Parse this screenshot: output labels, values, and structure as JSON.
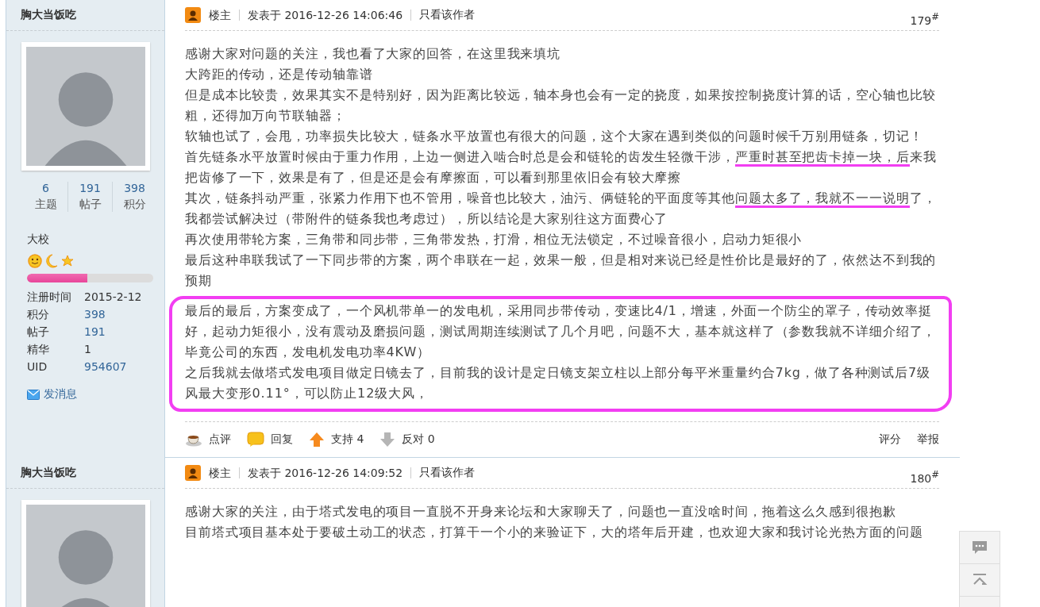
{
  "posts": [
    {
      "author": "胸大当饭吃",
      "stats": [
        {
          "value": "6",
          "label": "主题"
        },
        {
          "value": "191",
          "label": "帖子"
        },
        {
          "value": "398",
          "label": "积分"
        }
      ],
      "rank": "大校",
      "level": 0.48,
      "info": [
        {
          "label": "注册时间",
          "value": "2015-2-12",
          "linked": false
        },
        {
          "label": "积分",
          "value": "398",
          "linked": true
        },
        {
          "label": "帖子",
          "value": "191",
          "linked": true
        },
        {
          "label": "精华",
          "value": "1",
          "linked": false
        },
        {
          "label": "UID",
          "value": "954607",
          "linked": true
        }
      ],
      "message": "发消息",
      "badge": "楼主",
      "time": "发表于 2016-12-26 14:06:46",
      "only_author": "只看该作者",
      "floor": "179$^{#}$",
      "blocks": [
        {
          "highlighted": false,
          "paragraphs": [
            [
              {
                "text": "感谢大家对问题的关注，我也看了大家的回答，在这里我来填坑",
                "underlined": false
              }
            ],
            [
              {
                "text": "大跨距的传动，还是传动轴靠谱",
                "underlined": false
              }
            ],
            [
              {
                "text": "但是成本比较贵，效果其实不是特别好，因为距离比较远，轴本身也会有一定的挠度，如果按控制挠度计算的话，空心轴也比较粗，还得加万向节联轴器；",
                "underlined": false
              }
            ],
            [
              {
                "text": "软轴也试了，会甩，功率损失比较大，链条水平放置也有很大的问题，这个大家在遇到类似的问题时候千万别用链条，切记！",
                "underlined": false
              }
            ],
            [
              {
                "text": "首先链条水平放置时候由于重力作用，上边一侧进入啮合时总是会和链轮的齿发生轻微干涉，",
                "underlined": false
              },
              {
                "text": "严重时甚至把齿卡掉一块，后",
                "underlined": true
              },
              {
                "text": "来我把齿修了一下，效果是有了，但是还是会有摩擦面，可以看到那里依旧会有较大摩擦",
                "underlined": false
              }
            ],
            [
              {
                "text": "其次，链条抖动严重，张紧力作用下也不管用，噪音也比较大，油污、俩链轮的平面度等其他",
                "underlined": false
              },
              {
                "text": "问题太多了，我就不一一说明",
                "underlined": true
              },
              {
                "text": "了，我都尝试解决过（带附件的链条我也考虑过），所以结论是大家别往这方面费心了",
                "underlined": false
              }
            ],
            [
              {
                "text": "再次使用带轮方案，三角带和同步带，三角带发热，打滑，相位无法锁定，不过噪音很小，启动力矩很小",
                "underlined": false
              }
            ],
            [
              {
                "text": "最后这种串联我试了一下同步带的方案，两个串联在一起，效果一般，但是相对来说已经是性价比是最好的了，依然达不到我的预期",
                "underlined": false
              }
            ]
          ]
        },
        {
          "highlighted": true,
          "paragraphs": [
            [
              {
                "text": "最后的最后，方案变成了，一个风机带单一的发电机，采用同步带传动，变速比4/1，增速，外面一个防尘的罩子，传动效率挺好，起动力矩很小，没有震动及磨损问题，测试周期连续测试了几个月吧，问题不大，基本就这样了（参数我就不详细介绍了，毕竟公司的东西，发电机发电功率4KW）",
                "underlined": false
              }
            ],
            [
              {
                "text": "之后我就去做塔式发电项目做定日镜去了，目前我的设计是定日镜支架立柱以上部分每平米重量约合7kg，做了各种测试后7级风最大变形0.11°，可以防止12级大风，",
                "underlined": false
              }
            ]
          ]
        }
      ],
      "actions": [
        {
          "kind": "rate",
          "label": "点评"
        },
        {
          "kind": "reply",
          "label": "回复"
        },
        {
          "kind": "up",
          "label": "支持 4"
        },
        {
          "kind": "down",
          "label": "反对 0"
        }
      ],
      "side_actions": [
        "评分",
        "举报"
      ]
    },
    {
      "author": "胸大当饭吃",
      "badge": "楼主",
      "time": "发表于 2016-12-26 14:09:52",
      "only_author": "只看该作者",
      "floor": "180$^{#}$",
      "blocks": [
        {
          "highlighted": false,
          "paragraphs": [
            [
              {
                "text": "感谢大家的关注，由于塔式发电的项目一直脱不开身来论坛和大家聊天了，问题也一直没啥时间，拖着这么久感到很抱歉",
                "underlined": false
              }
            ],
            [
              {
                "text": "目前塔式项目基本处于要破土动工的状态，打算干一个小的来验证下，大的塔年后开建，也欢迎大家和我讨论光热方面的问题",
                "underlined": false
              }
            ]
          ]
        }
      ]
    }
  ]
}
